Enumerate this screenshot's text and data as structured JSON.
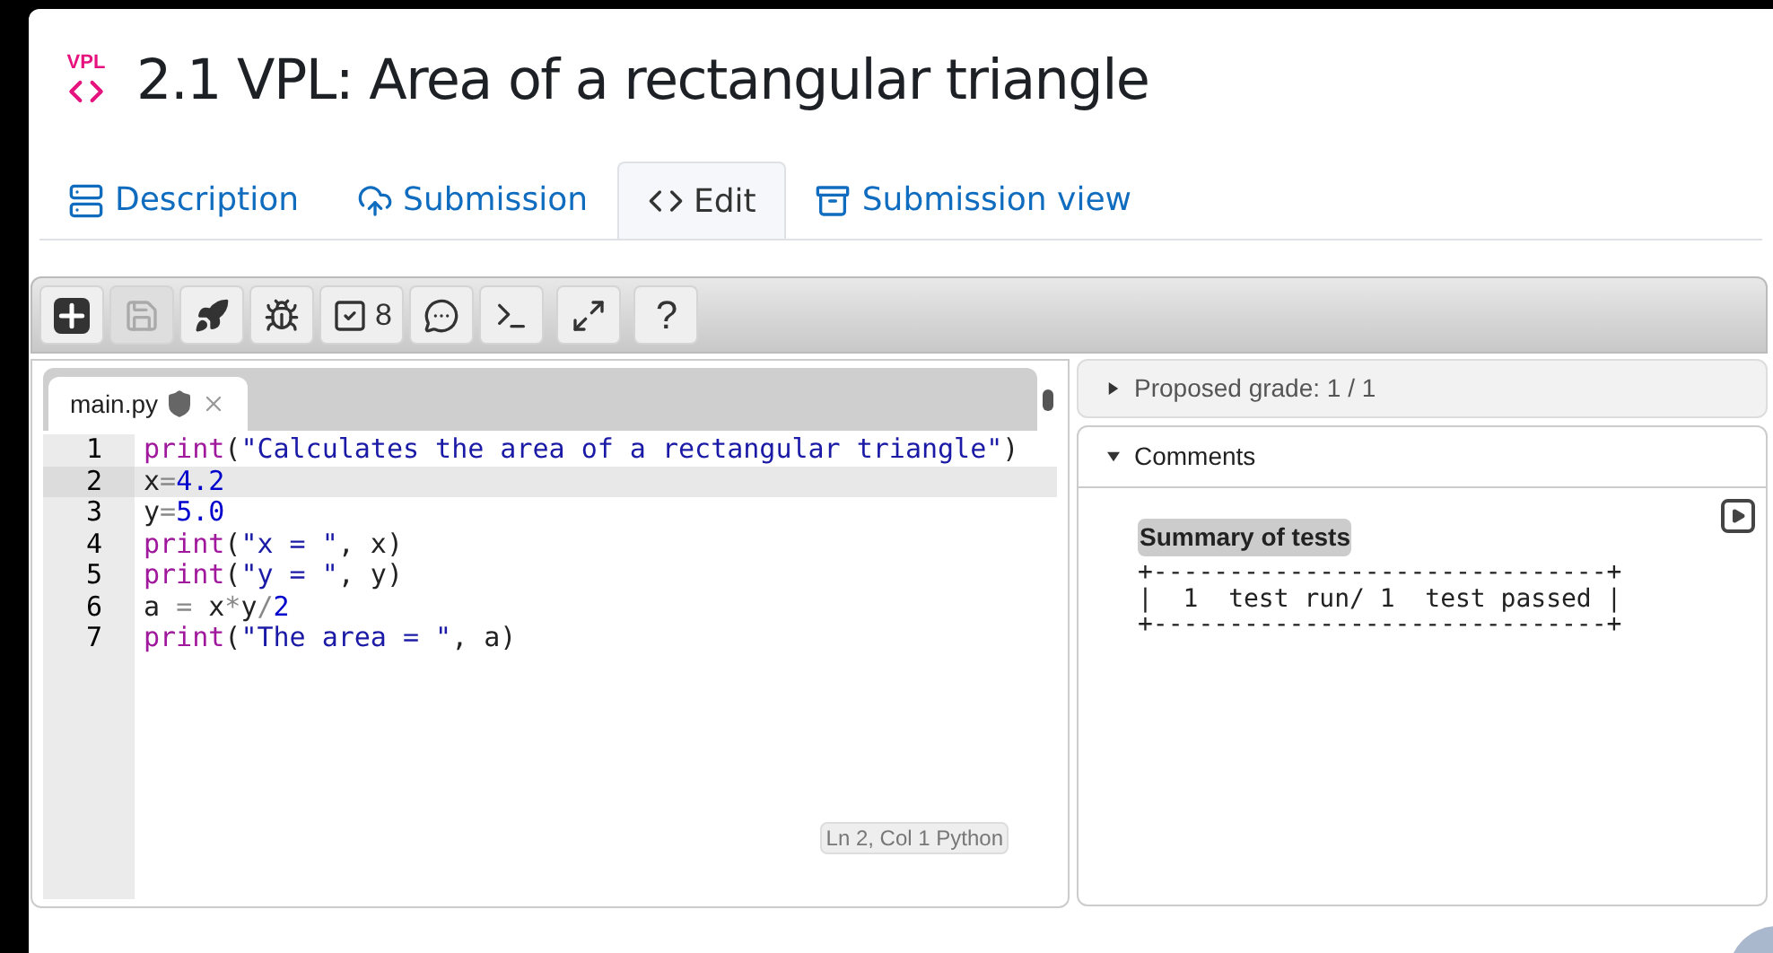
{
  "page": {
    "badge": "VPL",
    "title": "2.1 VPL: Area of a rectangular triangle"
  },
  "tabs": [
    {
      "kind": "description",
      "label": "Description",
      "selected": false
    },
    {
      "kind": "submission",
      "label": "Submission",
      "selected": false
    },
    {
      "kind": "edit",
      "label": "Edit",
      "selected": true
    },
    {
      "kind": "view",
      "label": "Submission view",
      "selected": false
    }
  ],
  "toolbar": [
    {
      "kind": "new",
      "disabled": false
    },
    {
      "kind": "save",
      "disabled": true
    },
    {
      "kind": "run",
      "disabled": false
    },
    {
      "kind": "debug",
      "disabled": false
    },
    {
      "kind": "evaluate",
      "label": "8",
      "disabled": false
    },
    {
      "kind": "comments",
      "disabled": false
    },
    {
      "kind": "console",
      "disabled": false
    },
    {
      "kind": "fullscreen",
      "disabled": false
    },
    {
      "kind": "help",
      "label": "?",
      "disabled": false
    }
  ],
  "editor": {
    "file_tab": "main.py",
    "lines": [
      {
        "number": "1",
        "selected": false,
        "tokens": [
          {
            "kind": "fn",
            "text": "print"
          },
          {
            "kind": "plain",
            "text": "("
          },
          {
            "kind": "str",
            "text": "\"Calculates the area of a rectangular triangle\""
          },
          {
            "kind": "plain",
            "text": ")"
          }
        ]
      },
      {
        "number": "2",
        "selected": true,
        "tokens": [
          {
            "kind": "plain",
            "text": "x"
          },
          {
            "kind": "op",
            "text": "="
          },
          {
            "kind": "num",
            "text": "4.2"
          }
        ]
      },
      {
        "number": "3",
        "selected": false,
        "tokens": [
          {
            "kind": "plain",
            "text": "y"
          },
          {
            "kind": "op",
            "text": "="
          },
          {
            "kind": "num",
            "text": "5.0"
          }
        ]
      },
      {
        "number": "4",
        "selected": false,
        "tokens": [
          {
            "kind": "fn",
            "text": "print"
          },
          {
            "kind": "plain",
            "text": "("
          },
          {
            "kind": "str",
            "text": "\"x = \""
          },
          {
            "kind": "plain",
            "text": ", x)"
          }
        ]
      },
      {
        "number": "5",
        "selected": false,
        "tokens": [
          {
            "kind": "fn",
            "text": "print"
          },
          {
            "kind": "plain",
            "text": "("
          },
          {
            "kind": "str",
            "text": "\"y = \""
          },
          {
            "kind": "plain",
            "text": ", y)"
          }
        ]
      },
      {
        "number": "6",
        "selected": false,
        "tokens": [
          {
            "kind": "plain",
            "text": "a "
          },
          {
            "kind": "op",
            "text": "="
          },
          {
            "kind": "plain",
            "text": " x"
          },
          {
            "kind": "op",
            "text": "*"
          },
          {
            "kind": "plain",
            "text": "y"
          },
          {
            "kind": "op",
            "text": "/"
          },
          {
            "kind": "num",
            "text": "2"
          }
        ]
      },
      {
        "number": "7",
        "selected": false,
        "tokens": [
          {
            "kind": "fn",
            "text": "print"
          },
          {
            "kind": "plain",
            "text": "("
          },
          {
            "kind": "str",
            "text": "\"The area = \""
          },
          {
            "kind": "plain",
            "text": ", a)"
          }
        ]
      }
    ],
    "status": "Ln 2, Col 1 Python"
  },
  "results": {
    "grade": {
      "label": "Proposed grade: 1 / 1",
      "expanded": false
    },
    "comments": {
      "label": "Comments",
      "expanded": true,
      "summary_title": "Summary of tests",
      "summary_lines": [
        "+------------------------------+",
        "|  1  test run/ 1  test passed |",
        "+------------------------------+"
      ]
    }
  }
}
